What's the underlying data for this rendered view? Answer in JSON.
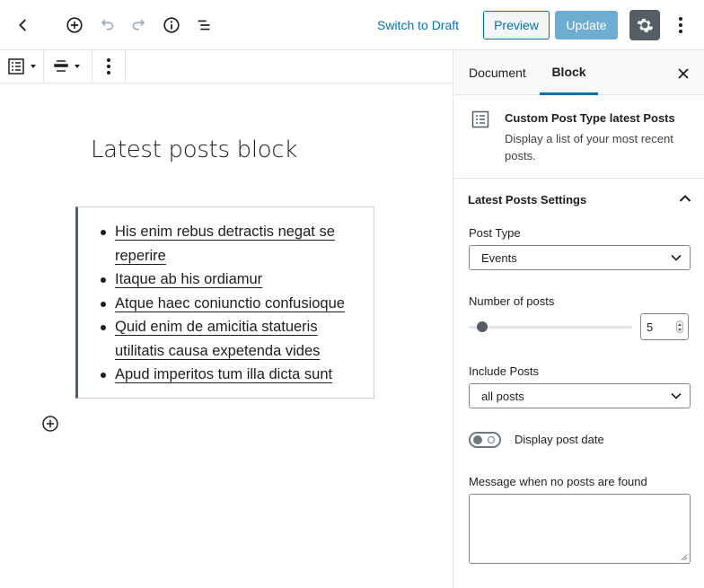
{
  "topbar": {
    "switch_to_draft": "Switch to Draft",
    "preview": "Preview",
    "update": "Update",
    "icons": [
      "back-icon",
      "add-block-icon",
      "undo-icon",
      "redo-icon",
      "info-icon",
      "outline-icon",
      "gear-icon",
      "more-vertical-icon"
    ]
  },
  "block_toolbar": {
    "icons": [
      "list-icon",
      "align-center-icon",
      "more-vertical-icon"
    ]
  },
  "editor": {
    "title": "Latest posts block",
    "posts": [
      "His enim rebus detractis negat se reperire",
      "Itaque ab his ordiamur",
      "Atque haec coniunctio confusioque",
      "Quid enim de amicitia statueris utilitatis causa expetenda vides",
      "Apud imperitos tum illa dicta sunt"
    ]
  },
  "sidebar": {
    "tabs": {
      "document": "Document",
      "block": "Block",
      "active": "Block"
    },
    "block_card": {
      "title": "Custom Post Type latest Posts",
      "description": "Display a list of your most recent posts."
    },
    "panel": {
      "title": "Latest Posts Settings",
      "post_type_label": "Post Type",
      "post_type_value": "Events",
      "number_label": "Number of posts",
      "number_value": "5",
      "number_fraction": 0.08,
      "include_label": "Include Posts",
      "include_value": "all posts",
      "display_date_label": "Display post date",
      "display_date_on": false,
      "message_label": "Message when no posts are found",
      "message_value": ""
    }
  },
  "colors": {
    "accent": "#0073aa",
    "update_button": "#66a9d0",
    "settings_active": "#555d66"
  }
}
